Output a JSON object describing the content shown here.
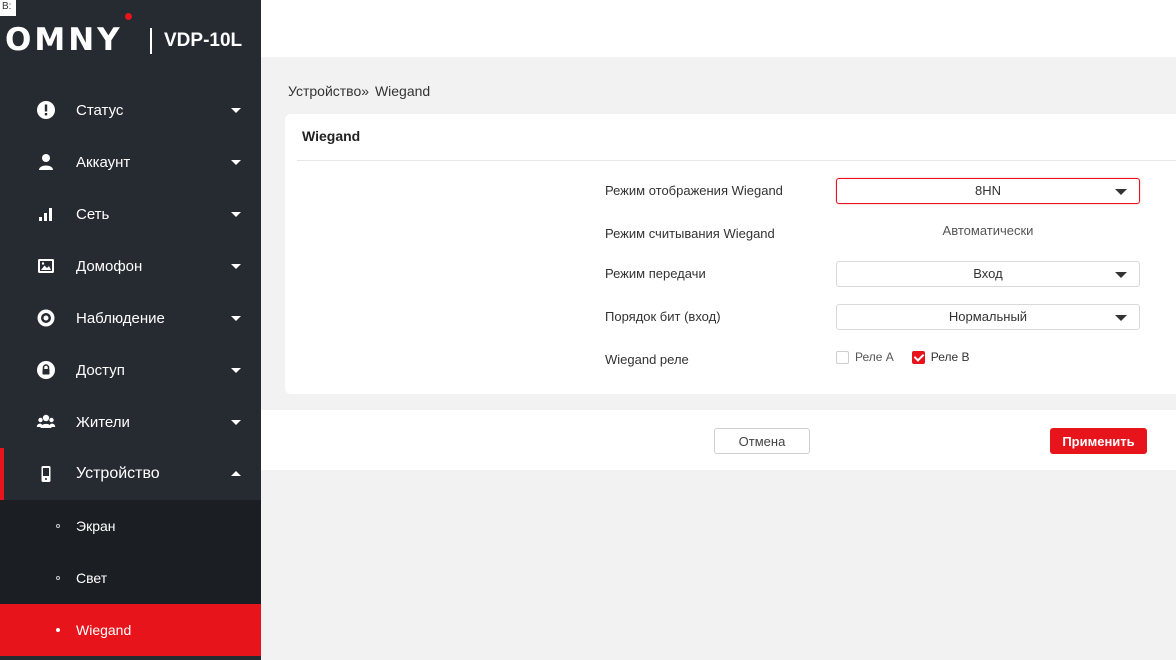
{
  "corner_text": "B:",
  "brand": {
    "logo": "OMNY",
    "model": "VDP-10L"
  },
  "colors": {
    "accent": "#e8141b",
    "sidebar": "#262a31",
    "submenu": "#1b1f24"
  },
  "sidebar": {
    "items": [
      {
        "label": "Статус",
        "icon": "status-icon"
      },
      {
        "label": "Аккаунт",
        "icon": "account-icon"
      },
      {
        "label": "Сеть",
        "icon": "network-icon"
      },
      {
        "label": "Домофон",
        "icon": "intercom-icon"
      },
      {
        "label": "Наблюдение",
        "icon": "surveillance-icon"
      },
      {
        "label": "Доступ",
        "icon": "access-icon"
      },
      {
        "label": "Жители",
        "icon": "residents-icon"
      },
      {
        "label": "Устройство",
        "icon": "device-icon"
      }
    ],
    "submenu": [
      {
        "label": "Экран"
      },
      {
        "label": "Свет"
      },
      {
        "label": "Wiegand"
      }
    ]
  },
  "breadcrumb": {
    "parent": "Устройство",
    "separator": "»",
    "current": "Wiegand"
  },
  "card": {
    "title": "Wiegand",
    "fields": {
      "display_mode": {
        "label": "Режим отображения Wiegand",
        "value": "8HN"
      },
      "read_mode": {
        "label": "Режим считывания Wiegand",
        "value": "Автоматически"
      },
      "transfer_mode": {
        "label": "Режим передачи",
        "value": "Вход"
      },
      "bit_order": {
        "label": "Порядок бит (вход)",
        "value": "Нормальный"
      },
      "relay": {
        "label": "Wiegand реле",
        "options": [
          {
            "label": "Реле А",
            "checked": false
          },
          {
            "label": "Реле В",
            "checked": true
          }
        ]
      }
    }
  },
  "footer": {
    "cancel_label": "Отмена",
    "apply_label": "Применить"
  }
}
